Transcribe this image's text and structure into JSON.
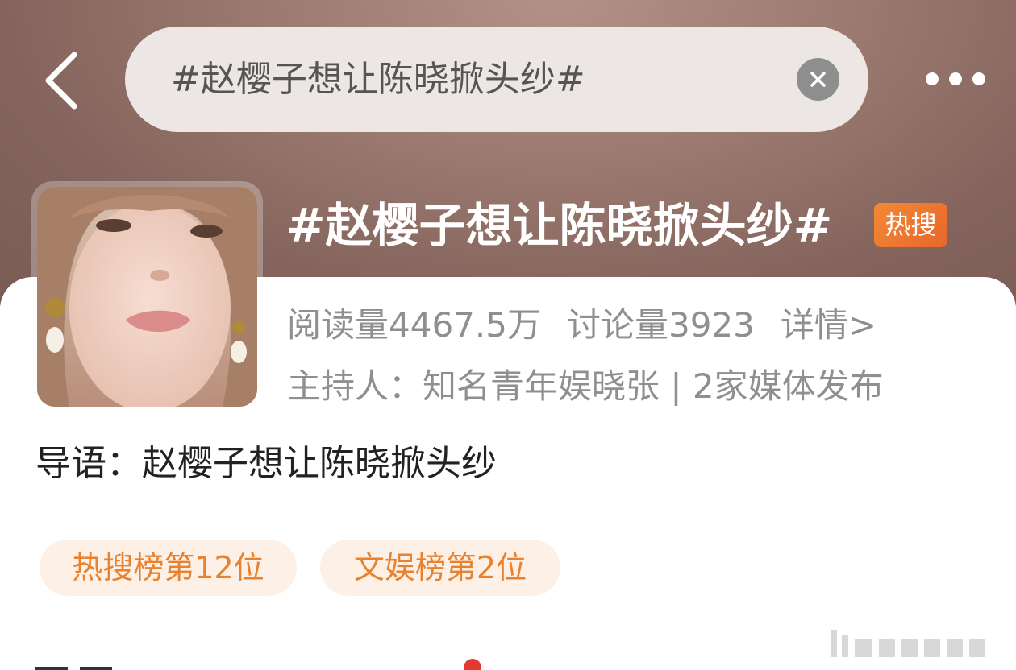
{
  "header": {
    "search_query": "#赵樱子想让陈晓掀头纱#",
    "back_icon": "chevron-left-icon",
    "clear_icon": "close-circle-icon",
    "more_icon": "more-dots-icon",
    "background_color": "#9d7b72"
  },
  "topic": {
    "title": "#赵樱子想让陈晓掀头纱#",
    "badge": "热搜",
    "badge_color": "#ee7a30",
    "read_count": "阅读量4467.5万",
    "discuss_count": "讨论量3923",
    "details_link": "详情>",
    "host_info": "主持人：知名青年娱晓张 | 2家媒体发布",
    "intro": "导语：赵樱子想让陈晓掀头纱"
  },
  "rankings": [
    {
      "label": "热搜榜第12位"
    },
    {
      "label": "文娱榜第2位"
    }
  ],
  "colors": {
    "accent": "#e8822f",
    "tag_background": "#fdf0e6",
    "secondary_text": "#8f8f8f"
  }
}
